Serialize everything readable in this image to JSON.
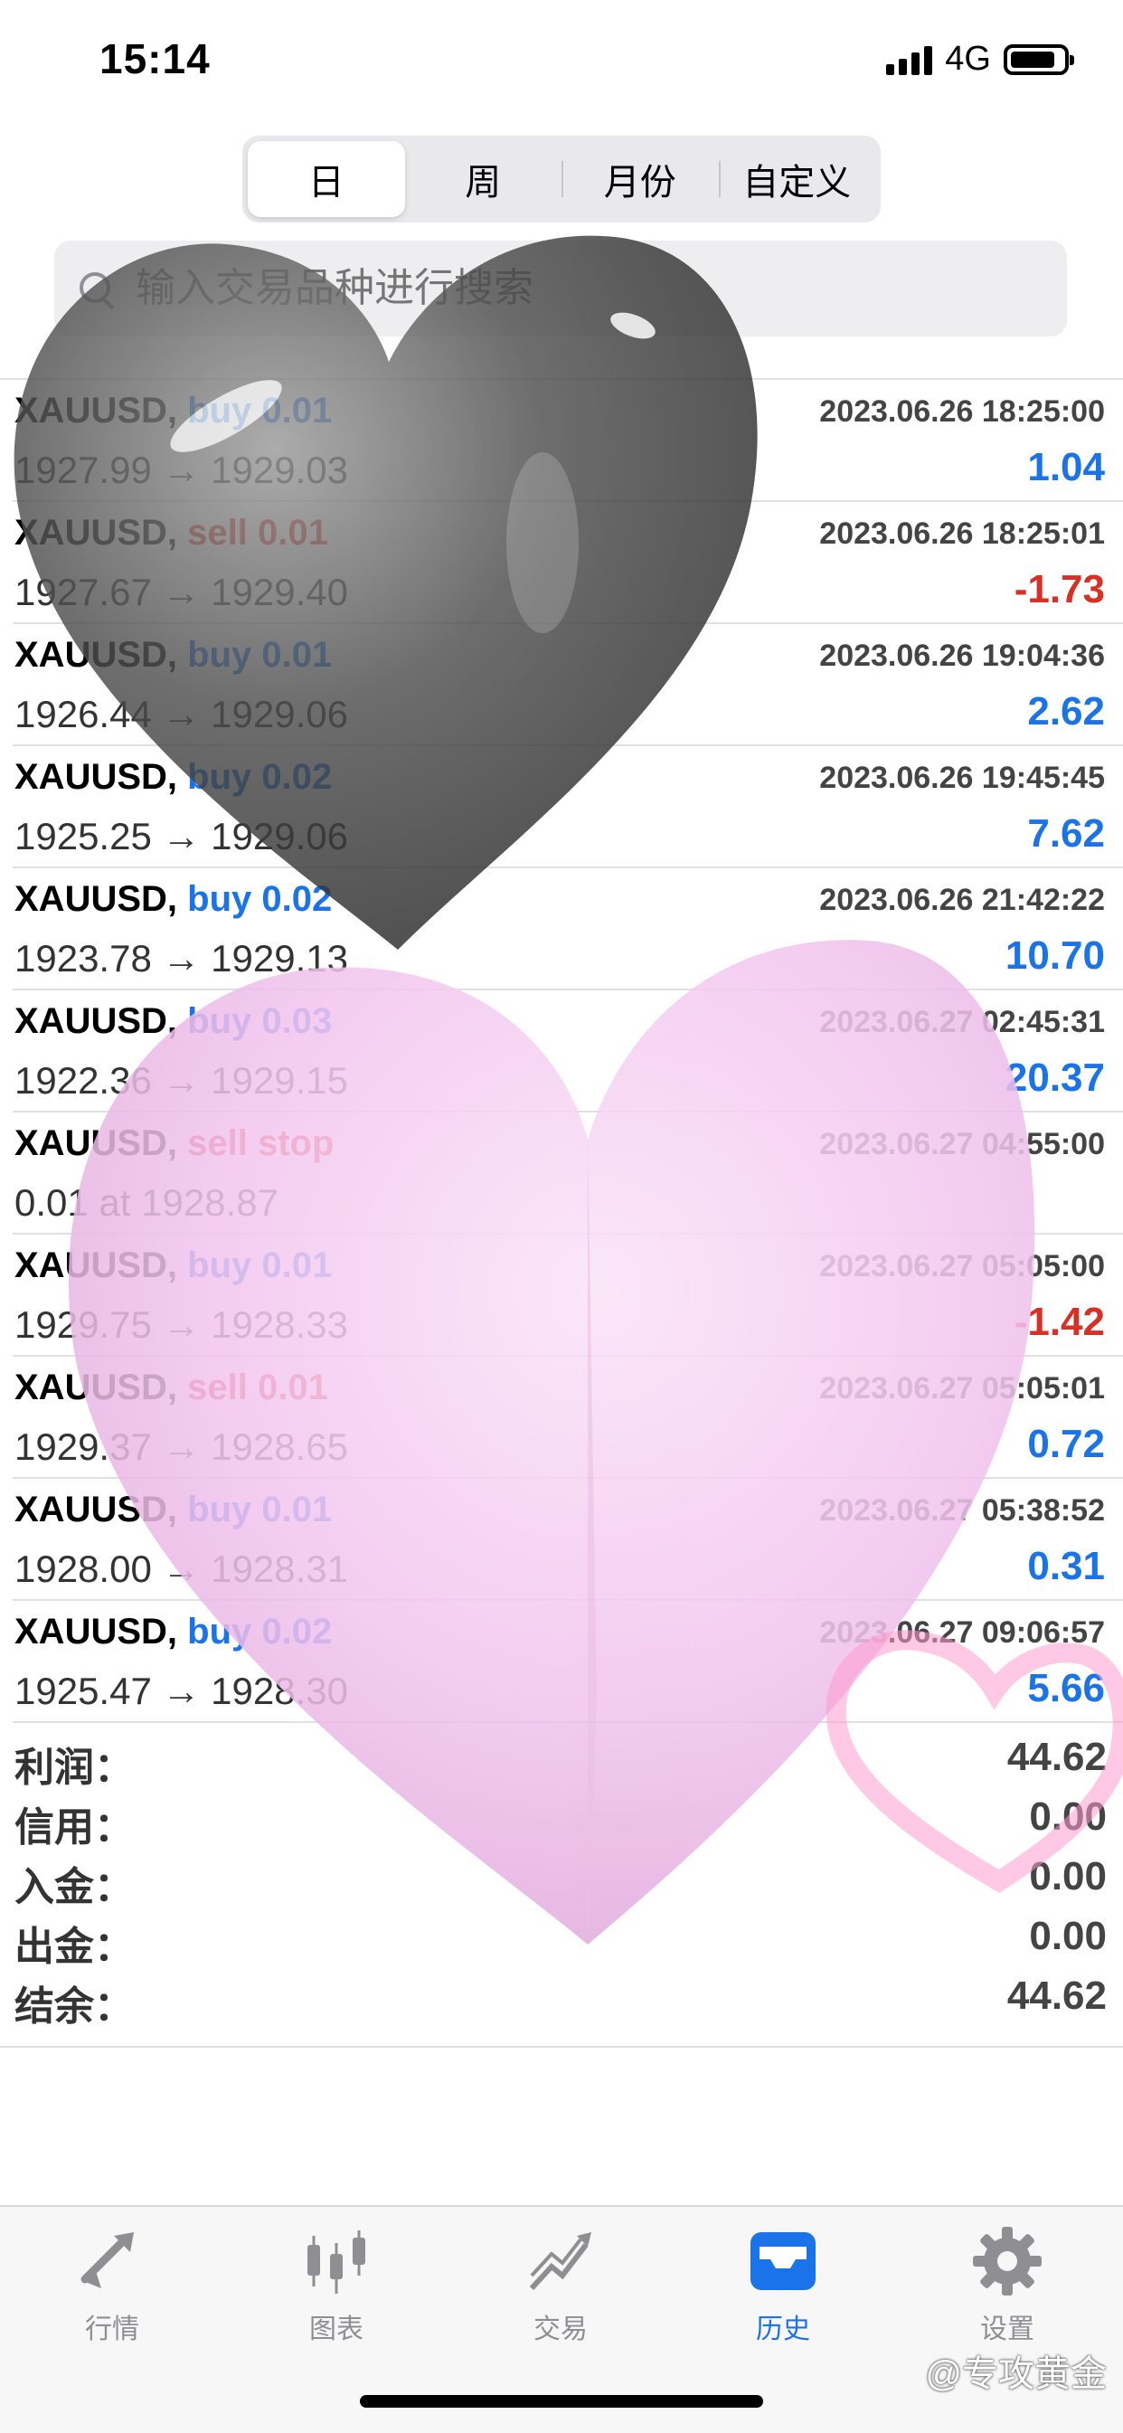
{
  "status_bar": {
    "time": "15:14",
    "network": "4G"
  },
  "segmented_control": [
    {
      "label": "日",
      "active": true
    },
    {
      "label": "周",
      "active": false
    },
    {
      "label": "月份",
      "active": false
    },
    {
      "label": "自定义",
      "active": false
    }
  ],
  "search": {
    "placeholder": "输入交易品种进行搜索"
  },
  "history": [
    {
      "symbol": "XAUUSD,",
      "type": "buy",
      "action": "buy 0.01",
      "prices": "1927.99 → 1929.03",
      "time": "2023.06.26 18:25:00",
      "profit": "1.04"
    },
    {
      "symbol": "XAUUSD,",
      "type": "sell",
      "action": "sell 0.01",
      "prices": "1927.67 → 1929.40",
      "time": "2023.06.26 18:25:01",
      "profit": "-1.73"
    },
    {
      "symbol": "XAUUSD,",
      "type": "buy",
      "action": "buy 0.01",
      "prices": "1926.44 → 1929.06",
      "time": "2023.06.26 19:04:36",
      "profit": "2.62"
    },
    {
      "symbol": "XAUUSD,",
      "type": "buy",
      "action": "buy 0.02",
      "prices": "1925.25 → 1929.06",
      "time": "2023.06.26 19:45:45",
      "profit": "7.62"
    },
    {
      "symbol": "XAUUSD,",
      "type": "buy",
      "action": "buy 0.02",
      "prices": "1923.78 → 1929.13",
      "time": "2023.06.26 21:42:22",
      "profit": "10.70"
    },
    {
      "symbol": "XAUUSD,",
      "type": "buy",
      "action": "buy 0.03",
      "prices": "1922.36 → 1929.15",
      "time": "2023.06.27 02:45:31",
      "profit": "20.37"
    },
    {
      "symbol": "XAUUSD,",
      "type": "sell",
      "action": "sell stop",
      "prices": "0.01 at 1928.87",
      "time": "2023.06.27 04:55:00",
      "profit": ""
    },
    {
      "symbol": "XAUUSD,",
      "type": "buy",
      "action": "buy 0.01",
      "prices": "1929.75 → 1928.33",
      "time": "2023.06.27 05:05:00",
      "profit": "-1.42"
    },
    {
      "symbol": "XAUUSD,",
      "type": "sell",
      "action": "sell 0.01",
      "prices": "1929.37 → 1928.65",
      "time": "2023.06.27 05:05:01",
      "profit": "0.72"
    },
    {
      "symbol": "XAUUSD,",
      "type": "buy",
      "action": "buy 0.01",
      "prices": "1928.00 → 1928.31",
      "time": "2023.06.27 05:38:52",
      "profit": "0.31"
    },
    {
      "symbol": "XAUUSD,",
      "type": "buy",
      "action": "buy 0.02",
      "prices": "1925.47 → 1928.30",
      "time": "2023.06.27 09:06:57",
      "profit": "5.66"
    }
  ],
  "summary": [
    {
      "label": "利润：",
      "value": "44.62"
    },
    {
      "label": "信用：",
      "value": "0.00"
    },
    {
      "label": "入金：",
      "value": "0.00"
    },
    {
      "label": "出金：",
      "value": "0.00"
    },
    {
      "label": "结余：",
      "value": "44.62"
    }
  ],
  "tabs": [
    {
      "label": "行情",
      "icon": "quotes-icon",
      "active": false
    },
    {
      "label": "图表",
      "icon": "chart-icon",
      "active": false
    },
    {
      "label": "交易",
      "icon": "trade-icon",
      "active": false
    },
    {
      "label": "历史",
      "icon": "history-icon",
      "active": true
    },
    {
      "label": "设置",
      "icon": "settings-icon",
      "active": false
    }
  ],
  "watermark": "@专攻黄金",
  "colors": {
    "accent": "#1a73e8",
    "loss": "#d93025",
    "heart_dark": "#4a4a4a",
    "heart_pink": "#f0c8ec"
  }
}
